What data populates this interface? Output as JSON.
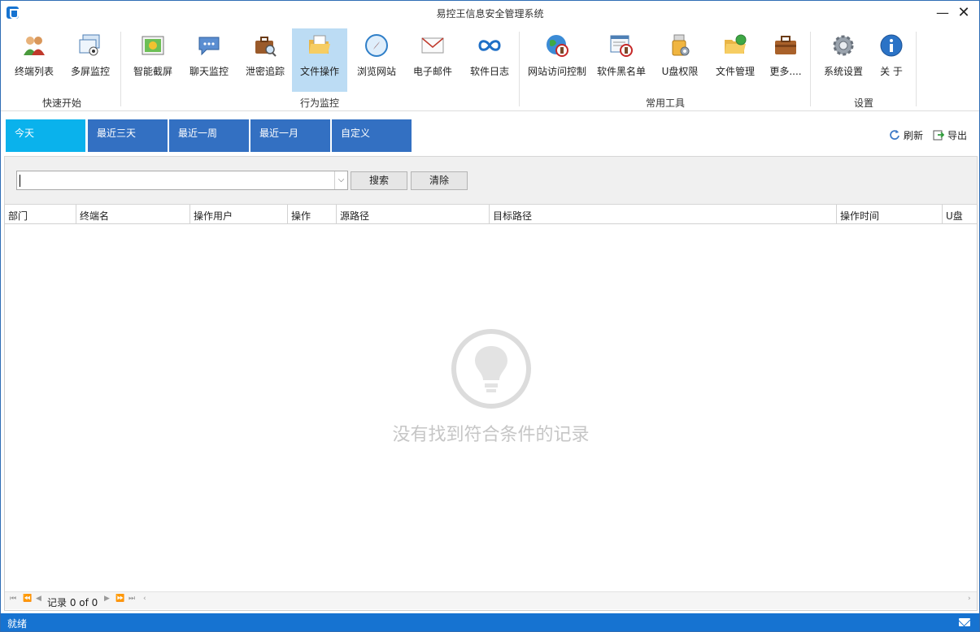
{
  "window": {
    "title": "易控王信息安全管理系统",
    "minimize_glyph": "—",
    "close_glyph": "✕"
  },
  "ribbon": {
    "items": [
      {
        "label": "终端列表",
        "icon": "users-icon"
      },
      {
        "label": "多屏监控",
        "icon": "multi-screen-icon"
      },
      {
        "label": "智能截屏",
        "icon": "screenshot-icon"
      },
      {
        "label": "聊天监控",
        "icon": "chat-bubble-icon"
      },
      {
        "label": "泄密追踪",
        "icon": "briefcase-search-icon"
      },
      {
        "label": "文件操作",
        "icon": "folder-open-icon"
      },
      {
        "label": "浏览网站",
        "icon": "compass-icon"
      },
      {
        "label": "电子邮件",
        "icon": "envelope-icon"
      },
      {
        "label": "软件日志",
        "icon": "infinity-icon"
      },
      {
        "label": "网站访问控制",
        "icon": "globe-block-icon"
      },
      {
        "label": "软件黑名单",
        "icon": "window-block-icon"
      },
      {
        "label": "U盘权限",
        "icon": "usb-settings-icon"
      },
      {
        "label": "文件管理",
        "icon": "folder-globe-icon"
      },
      {
        "label": "更多....",
        "icon": "toolbox-icon"
      },
      {
        "label": "系统设置",
        "icon": "gear-icon"
      },
      {
        "label": "关  于",
        "icon": "info-icon"
      }
    ],
    "groups": [
      "快速开始",
      "行为监控",
      "常用工具",
      "设置"
    ],
    "active_label": "文件操作"
  },
  "date_tabs": [
    "今天",
    "最近三天",
    "最近一周",
    "最近一月",
    "自定义"
  ],
  "actions": {
    "refresh": "刷新",
    "export": "导出"
  },
  "search": {
    "value": "",
    "dropdown_glyph": "⌵",
    "search_button": "搜索",
    "clear_button": "清除"
  },
  "table": {
    "columns": [
      "部门",
      "终端名",
      "操作用户",
      "操作",
      "源路径",
      "目标路径",
      "操作时间",
      "U盘"
    ],
    "rows": [],
    "empty_message": "没有找到符合条件的记录"
  },
  "pager": {
    "records_text": "记录 0 of 0"
  },
  "status": {
    "text": "就绪"
  },
  "colors": {
    "accent": "#1673d1",
    "tab": "#3370c2",
    "tab_active": "#0ab2ec",
    "ribbon_active": "#bcdcf4"
  }
}
